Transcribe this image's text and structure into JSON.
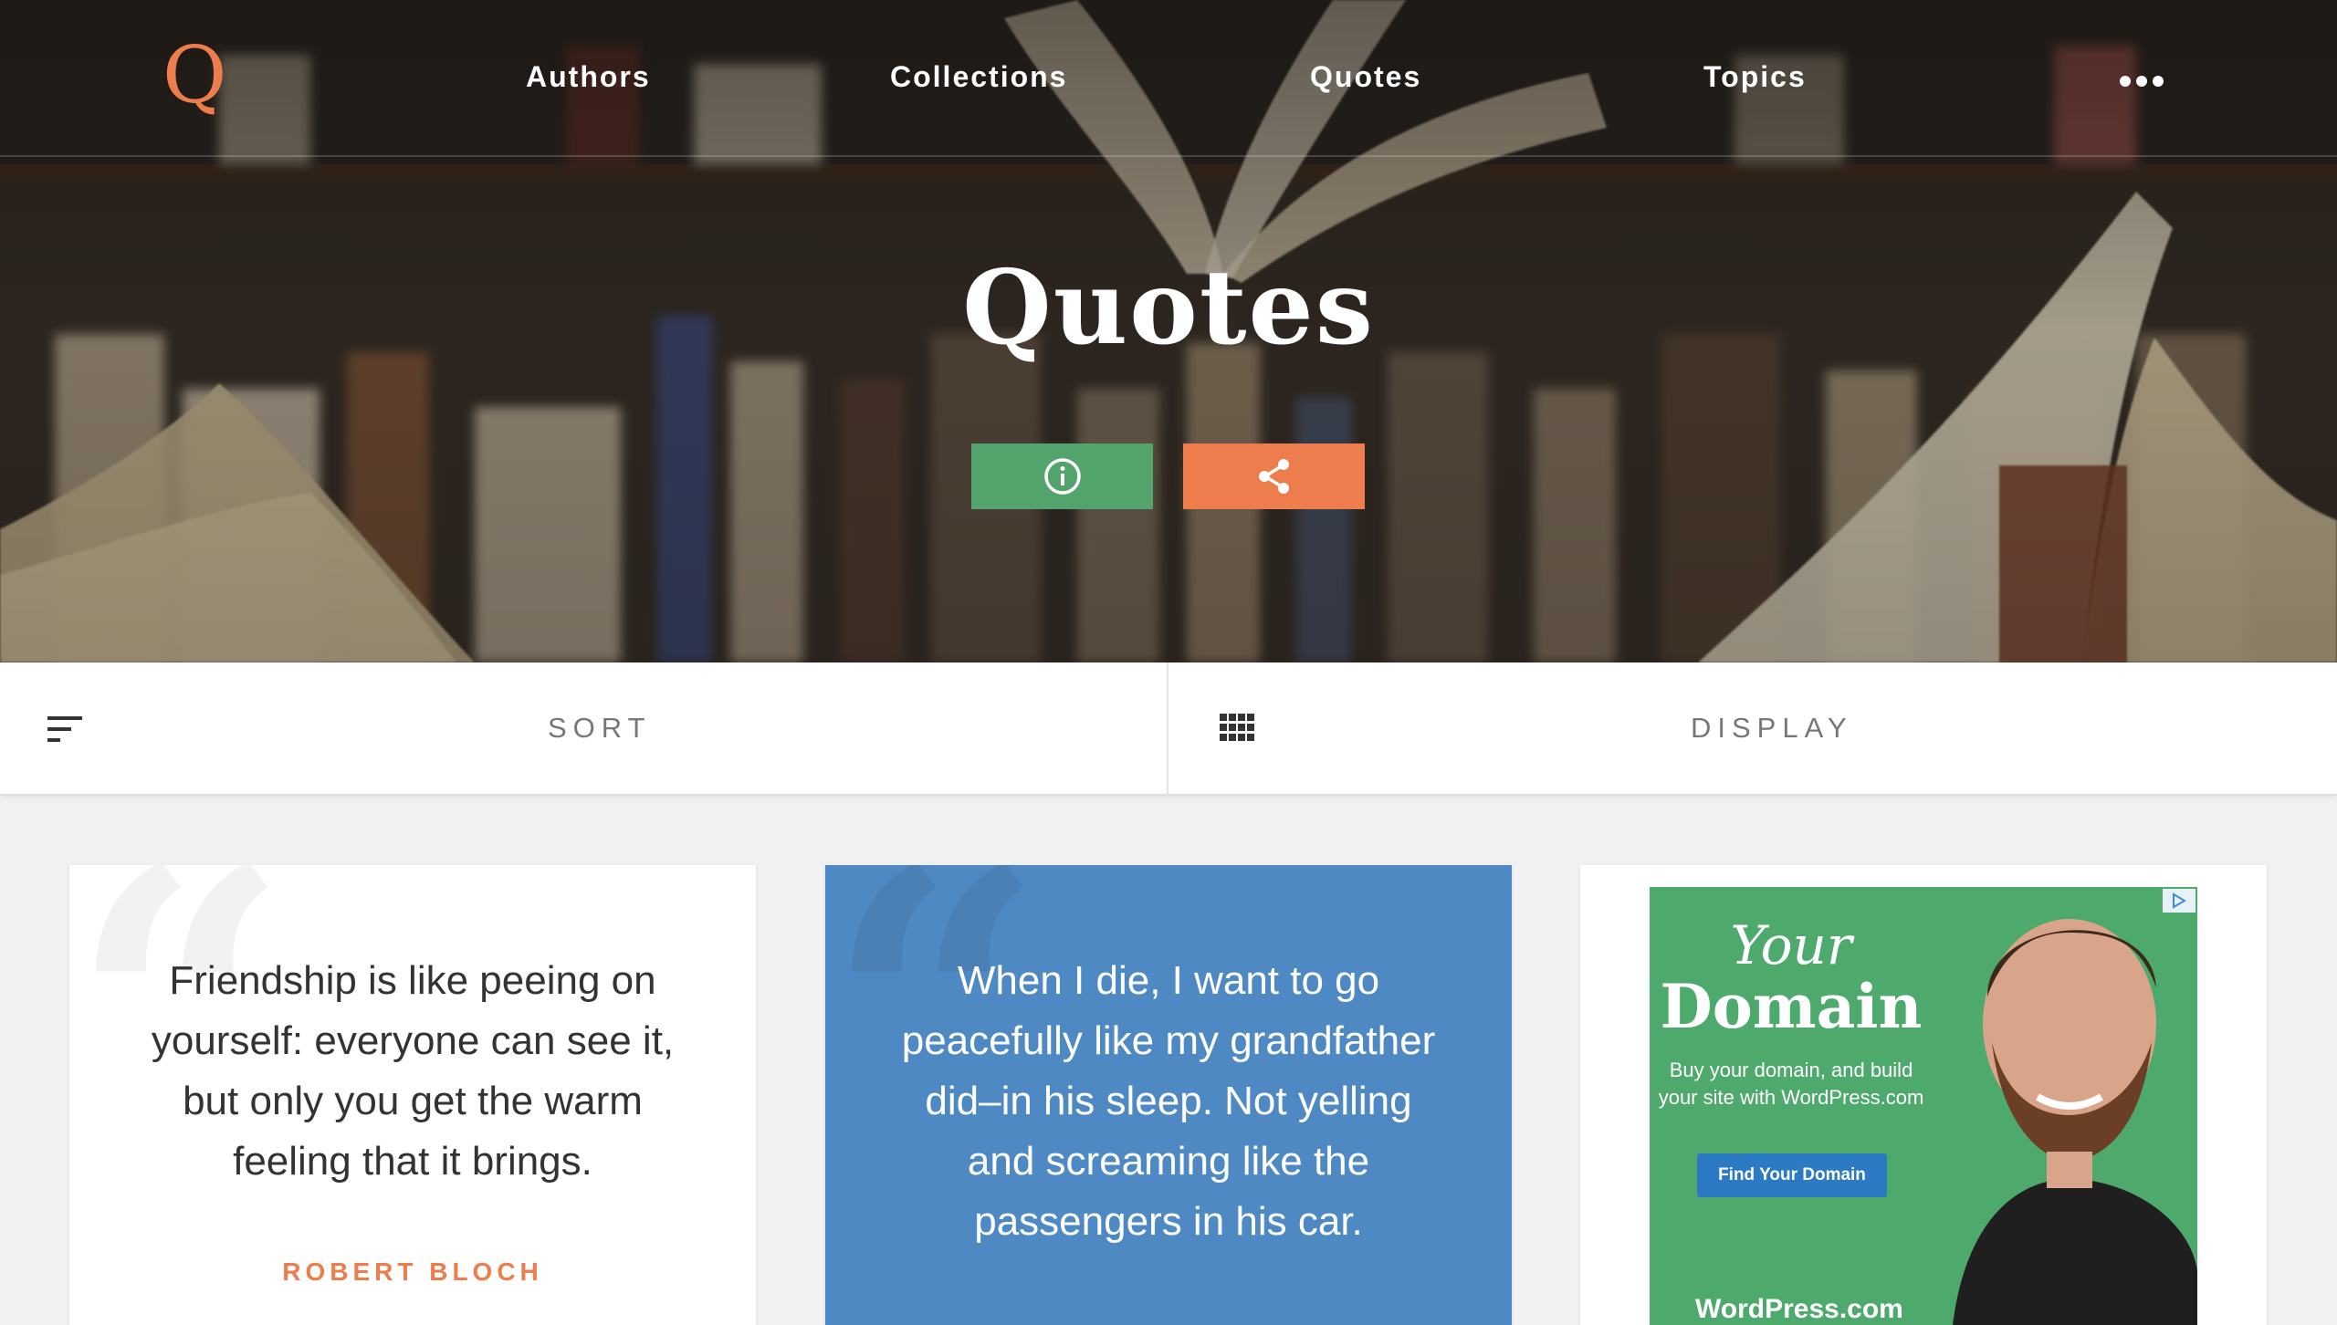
{
  "nav": {
    "logo": "Q",
    "links": [
      "Authors",
      "Collections",
      "Quotes",
      "Topics"
    ]
  },
  "hero": {
    "title": "Quotes"
  },
  "toolbar": {
    "sort_label": "SORT",
    "display_label": "DISPLAY"
  },
  "cards": [
    {
      "quote": "Friendship is like peeing on yourself: everyone can see it, but only you get the warm feeling that it brings.",
      "author": "ROBERT BLOCH"
    },
    {
      "quote": "When I die, I want to go peacefully like my grandfather did–in his sleep. Not yelling and screaming like the passengers in his car."
    }
  ],
  "ad": {
    "line1": "Your",
    "line2": "Domain",
    "copy": "Buy your domain, and build your site with WordPress.com",
    "button": "Find Your Domain",
    "brand": "WordPress.com"
  },
  "colors": {
    "accent_orange": "#ee7d4e",
    "info_green": "#52a36c",
    "quote_blue": "#4f89c3",
    "ad_green": "#4daa6c"
  }
}
